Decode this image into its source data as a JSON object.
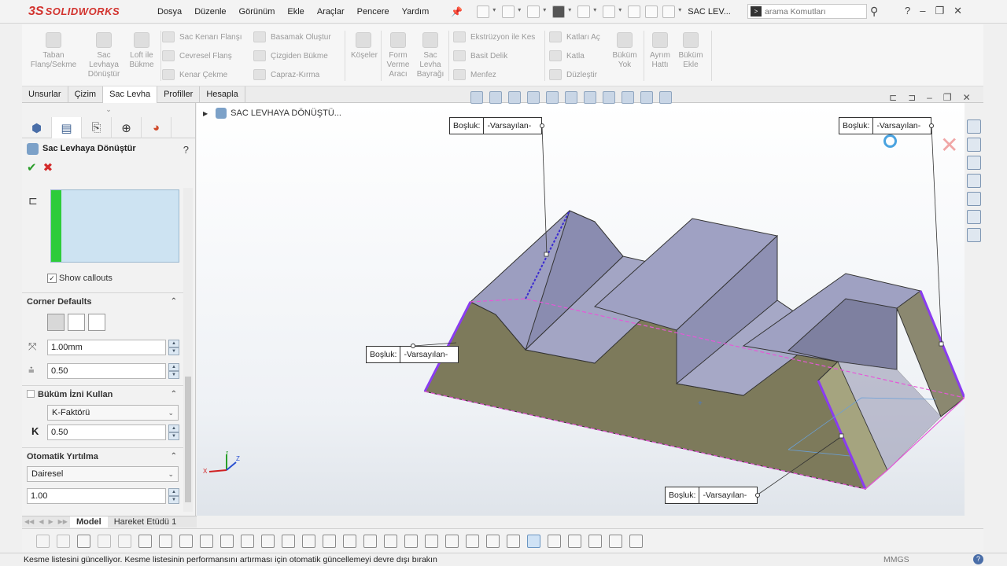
{
  "app": {
    "logo_ds": "3S",
    "logo_text": "SOLIDWORKS",
    "doc_title": "SAC LEV...",
    "search_placeholder": "arama Komutları"
  },
  "menus": [
    "Dosya",
    "Düzenle",
    "Görünüm",
    "Ekle",
    "Araçlar",
    "Pencere",
    "Yardım"
  ],
  "ribbon": {
    "big": [
      {
        "label": "Taban Flanş/Sekme"
      },
      {
        "label": "Sac Levhaya Dönüştür"
      },
      {
        "label": "Loft ile Bükme"
      },
      {
        "label": "Köşeler"
      },
      {
        "label": "Form Verme Aracı"
      },
      {
        "label": "Sac Levha Bayrağı"
      },
      {
        "label": "Büküm Yok"
      },
      {
        "label": "Ayrım Hattı"
      },
      {
        "label": "Büküm Ekle"
      }
    ],
    "small": [
      "Sac Kenarı Flanşı",
      "Cevresel Flanş",
      "Kenar Çekme",
      "Basamak Oluştur",
      "Çizgiden Bükme",
      "Capraz-Kırma",
      "Ekstrüzyon ile Kes",
      "Basit Delik",
      "Menfez",
      "Katları Aç",
      "Katla",
      "Düzleştir"
    ]
  },
  "cm_tabs": [
    "Unsurlar",
    "Çizim",
    "Sac Levha",
    "Profiller",
    "Hesapla"
  ],
  "property_manager": {
    "title": "Sac Levhaya Dönüştür",
    "help": "?",
    "show_callouts": "Show callouts",
    "corner_defaults": "Corner Defaults",
    "gap_value": "1.00mm",
    "ratio_value": "0.50",
    "bend_allowance": "Büküm İzni Kullan",
    "bend_type": "K-Faktörü",
    "k_label": "K",
    "k_value": "0.50",
    "auto_relief": "Otomatik Yırtılma",
    "relief_type": "Dairesel",
    "relief_value": "1.00"
  },
  "bottom_tabs": [
    "Model",
    "Hareket Etüdü 1"
  ],
  "tree": {
    "root": "SAC LEVHAYA DÖNÜŞTÜ..."
  },
  "callouts": [
    {
      "label": "Boşluk:",
      "value": "-Varsayılan-"
    },
    {
      "label": "Boşluk:",
      "value": "-Varsayılan-"
    },
    {
      "label": "Boşluk:",
      "value": "-Varsayılan-"
    },
    {
      "label": "Boşluk:",
      "value": "-Varsayılan-"
    }
  ],
  "status": {
    "message": "Kesme listesini güncelliyor. Kesme listesinin performansını artırması için otomatik güncellemeyi devre dışı bırakın",
    "units": "MMGS",
    "help": "?"
  },
  "triad": {
    "x": "X",
    "y": "Y",
    "z": "Z"
  },
  "colors": {
    "accent_red": "#d2322d",
    "model_face": "#7e7a5c",
    "model_top": "#9ea0bd",
    "bend_edge": "#8a3cf0",
    "pink_dash": "#e657d8",
    "sel_green": "#2dcc3a"
  }
}
